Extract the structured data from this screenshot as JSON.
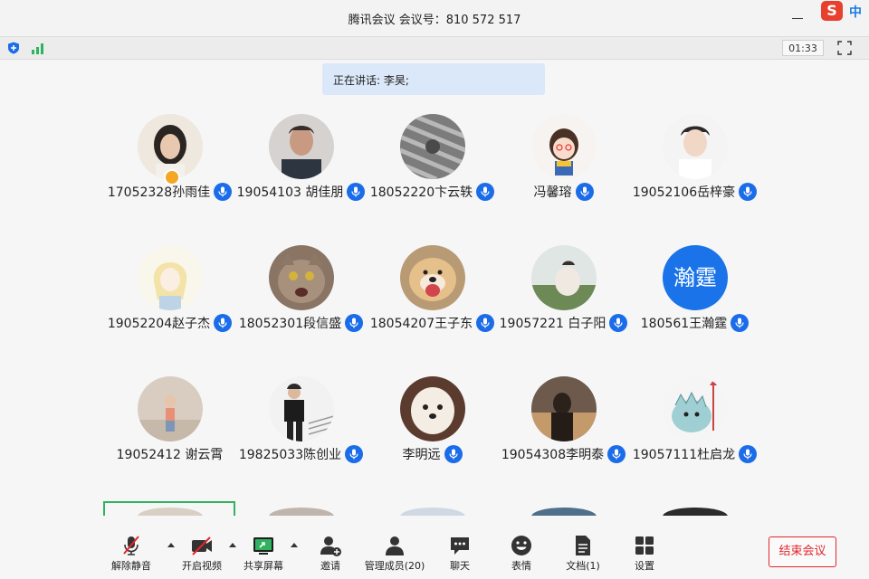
{
  "window": {
    "title": "腾讯会议  会议号：810 572 517",
    "ime_logo": "S",
    "ime_mode": "中"
  },
  "statusbar": {
    "timer": "01:33"
  },
  "speaking": "正在讲话: 李昊;",
  "participants": [
    {
      "name": "17052328孙雨佳",
      "mic": true,
      "host": true
    },
    {
      "name": "19054103 胡佳朋",
      "mic": true
    },
    {
      "name": "18052220卞云轶",
      "mic": true
    },
    {
      "name": "冯馨瑢",
      "mic": true
    },
    {
      "name": "19052106岳梓豪",
      "mic": true
    },
    {
      "name": "19052204赵子杰",
      "mic": true
    },
    {
      "name": "18052301段信盛",
      "mic": true
    },
    {
      "name": "18054207王子东",
      "mic": true
    },
    {
      "name": "19057221 白子阳",
      "mic": true
    },
    {
      "name": "180561王瀚霆",
      "mic": true,
      "avatar_text": "瀚霆"
    },
    {
      "name": "19052412 谢云霄",
      "mic": false
    },
    {
      "name": "19825033陈创业",
      "mic": true
    },
    {
      "name": "李明远",
      "mic": true
    },
    {
      "name": "19054308李明泰",
      "mic": true
    },
    {
      "name": "19057111杜启龙",
      "mic": true
    }
  ],
  "toolbar": {
    "unmute": "解除静音",
    "video": "开启视频",
    "share": "共享屏幕",
    "invite": "邀请",
    "members": "管理成员(20)",
    "chat": "聊天",
    "emoji": "表情",
    "docs": "文档(1)",
    "settings": "设置",
    "end": "结束会议"
  },
  "colors": {
    "accent": "#1b6ce8",
    "end_red": "#e2262b",
    "speaking_bg": "#dbe8f9",
    "selected_border": "#2fb35f"
  }
}
